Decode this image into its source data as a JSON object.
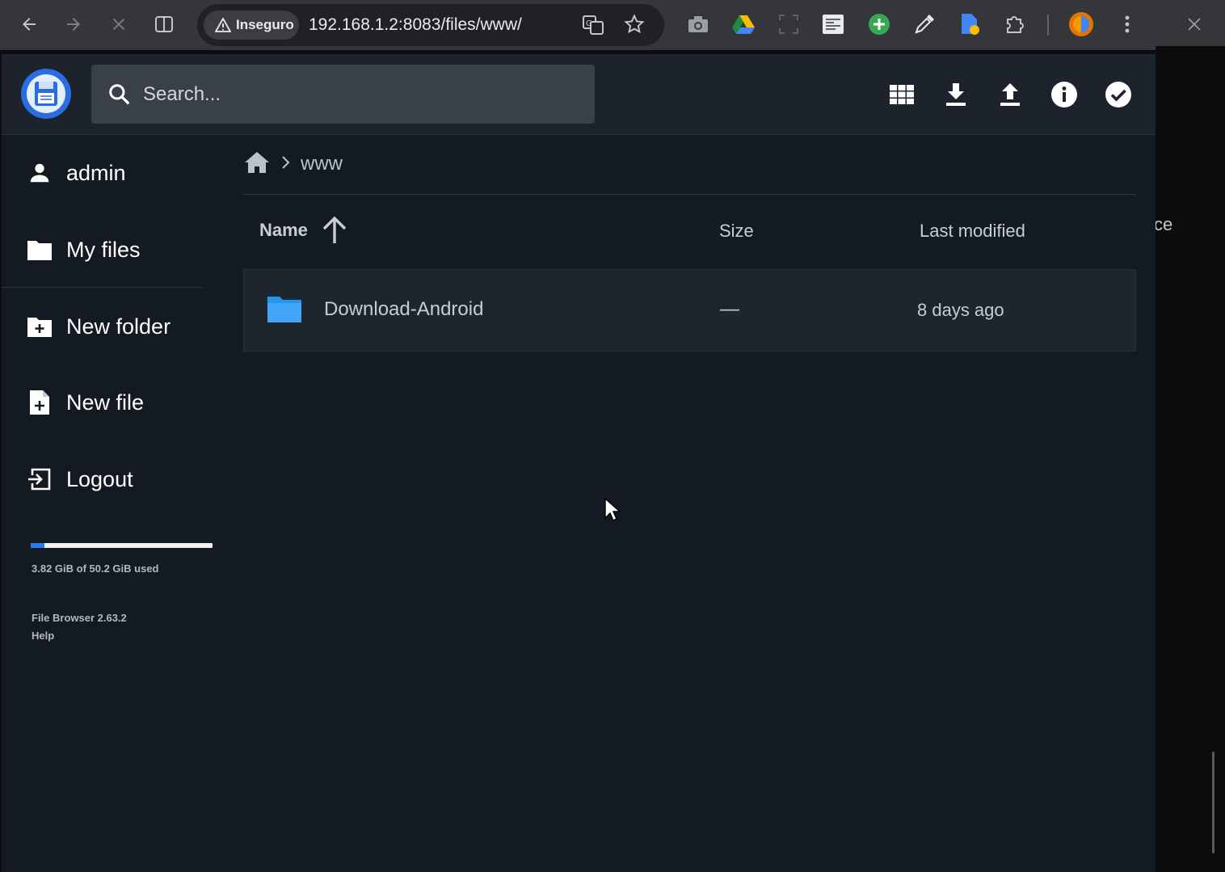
{
  "browser": {
    "security_label": "Inseguro",
    "url": "192.168.1.2:8083/files/www/"
  },
  "background_window": {
    "partial_text": "ce"
  },
  "header": {
    "search_placeholder": "Search...",
    "icons": [
      "grid-view-icon",
      "download-icon",
      "upload-icon",
      "info-icon",
      "select-icon"
    ]
  },
  "sidebar": {
    "items": [
      {
        "label": "admin",
        "icon": "user-icon"
      },
      {
        "label": "My files",
        "icon": "folder-icon"
      },
      {
        "label": "New folder",
        "icon": "new-folder-icon"
      },
      {
        "label": "New file",
        "icon": "new-file-icon"
      },
      {
        "label": "Logout",
        "icon": "logout-icon"
      }
    ],
    "quota": {
      "text": "3.82 GiB of 50.2 GiB used",
      "fraction": 0.076
    },
    "footer": {
      "version": "File Browser 2.63.2",
      "help": "Help"
    }
  },
  "breadcrumb": {
    "current": "www"
  },
  "listing": {
    "columns": {
      "name": "Name",
      "size": "Size",
      "modified": "Last modified"
    },
    "rows": [
      {
        "name": "Download-Android",
        "size": "—",
        "modified": "8 days ago",
        "type": "folder"
      }
    ]
  },
  "colors": {
    "accent": "#2d7bf4",
    "header_bg": "#1d232c",
    "page_bg": "#141a22",
    "folder": "#2196f3"
  }
}
